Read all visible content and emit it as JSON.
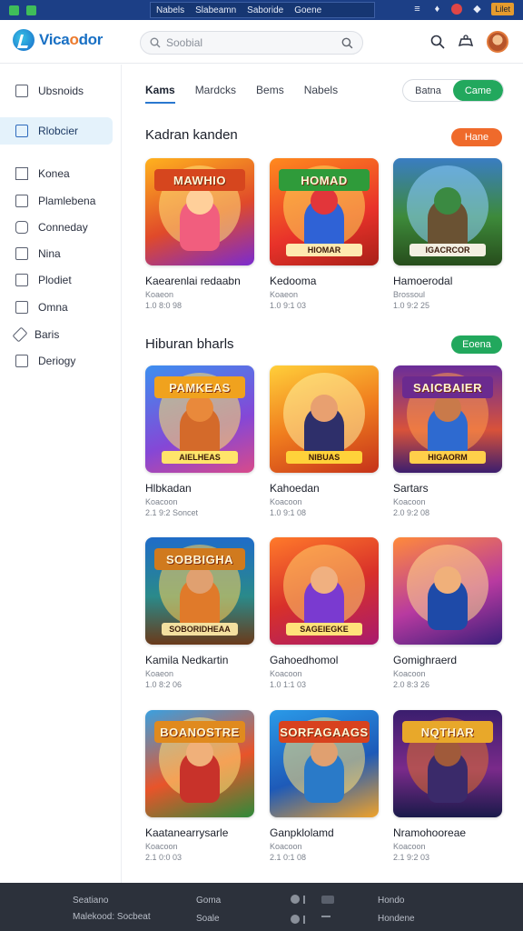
{
  "topbar": {
    "mid_items": [
      "Nabels",
      "Slabeamn",
      "Saboride",
      "Goene"
    ],
    "badge": "Lilet"
  },
  "header": {
    "logo_text_a": "Vica",
    "logo_text_b": "o",
    "logo_text_c": "dor",
    "search_placeholder": "Soobial"
  },
  "sidebar": {
    "items": [
      {
        "label": "Ubsnoids",
        "icon": "monitor-icon"
      },
      {
        "label": "Rlobcier",
        "icon": "calendar-icon"
      },
      {
        "label": "Konea",
        "icon": "triangle-icon"
      },
      {
        "label": "Plamlebena",
        "icon": "file-icon"
      },
      {
        "label": "Conneday",
        "icon": "chat-icon"
      },
      {
        "label": "Nina",
        "icon": "bookmark-icon"
      },
      {
        "label": "Plodiet",
        "icon": "check-icon"
      },
      {
        "label": "Omna",
        "icon": "display-icon"
      },
      {
        "label": "Baris",
        "icon": "pencil-icon"
      },
      {
        "label": "Deriogy",
        "icon": "square-icon"
      }
    ]
  },
  "tabs": [
    "Kams",
    "Mardcks",
    "Bems",
    "Nabels"
  ],
  "toggle": {
    "off": "Batna",
    "on": "Came"
  },
  "sections": [
    {
      "title": "Kadran kanden",
      "button": "Hane",
      "button_color": "#ef6a2b"
    },
    {
      "title": "Hiburan bharls",
      "button": "Eoena",
      "button_color": "#22a85d"
    }
  ],
  "cards": [
    {
      "name": "Kaearenlai redaabn",
      "meta1": "Koaeon",
      "meta2": "1.0 8:0 98",
      "banner": "MAWHIO",
      "plate": "",
      "bg": "linear-gradient(160deg,#ffb21e,#e04a2a 55%,#7a2bd0)",
      "sun": "#ffe27a",
      "char": "#f15e7e",
      "face": "#ffcf9a",
      "banner_bg": "#d6461e",
      "plate_bg": "#ffe27a"
    },
    {
      "name": "Kedooma",
      "meta1": "Koaeon",
      "meta2": "1.0 9:1 03",
      "banner": "HOMAD",
      "plate": "HIOMAR",
      "bg": "linear-gradient(160deg,#ff8a1e,#e8322a 60%,#a82018)",
      "sun": "#ffd85a",
      "char": "#2f62d6",
      "face": "#e2363a",
      "banner_bg": "#2f9b3a",
      "plate_bg": "#ffe9b0"
    },
    {
      "name": "Hamoerodal",
      "meta1": "Brossoul",
      "meta2": "1.0 9:2 25",
      "banner": "",
      "plate": "IGACRCOR",
      "bg": "linear-gradient(180deg,#3a7dc2,#3d8a3a 55%,#274d1c)",
      "sun": "#8fd0ff",
      "char": "#6a5233",
      "face": "#3b8a42",
      "banner_bg": "transparent",
      "plate_bg": "#f3efe2"
    },
    {
      "name": "Hlbkadan",
      "meta1": "Koacoon",
      "meta2": "2.1 9:2 Soncet",
      "banner": "PAMKEAS",
      "plate": "AIELHEAS",
      "bg": "linear-gradient(160deg,#3d8ff0,#8547d6 60%,#d84a8a)",
      "sun": "#ffe46a",
      "char": "#d46a2a",
      "face": "#e9893b",
      "banner_bg": "#f0a21e",
      "plate_bg": "#ffe46a"
    },
    {
      "name": "Kahoedan",
      "meta1": "Koacoon",
      "meta2": "1.0 9:1 08",
      "banner": "",
      "plate": "NIBUAS",
      "bg": "linear-gradient(160deg,#ffcf3a,#f07d1e 50%,#c5321a)",
      "sun": "#fff1a0",
      "char": "#2e2f6a",
      "face": "#e8a070",
      "banner_bg": "transparent",
      "plate_bg": "#ffd23a"
    },
    {
      "name": "Sartars",
      "meta1": "Koacoon",
      "meta2": "2.0 9:2 08",
      "banner": "SAICBAIER",
      "plate": "HIGAORM",
      "bg": "linear-gradient(180deg,#6a2d9a,#d8523a 60%,#3c1e6e)",
      "sun": "#ff9a4a",
      "char": "#2e6ad0",
      "face": "#c97a4a",
      "banner_bg": "#6b2a8f",
      "plate_bg": "#ffcf4a"
    },
    {
      "name": "Kamila Nedkartin",
      "meta1": "Koaeon",
      "meta2": "1.0 8:2 06",
      "banner": "SOBBIGHA",
      "plate": "SOBORIDHEAA",
      "bg": "linear-gradient(180deg,#1f6cc8,#2a8a8a 55%,#6a3a1a)",
      "sun": "#ffd25a",
      "char": "#e07a2a",
      "face": "#e0a070",
      "banner_bg": "#d07a1e",
      "plate_bg": "#f3e0a0"
    },
    {
      "name": "Gahoedhomol",
      "meta1": "Koacoon",
      "meta2": "1.0 1:1 03",
      "banner": "",
      "plate": "SAGEIEGKE",
      "bg": "linear-gradient(160deg,#ff7a2a,#d8302a 50%,#a81a6e)",
      "sun": "#ffd06a",
      "char": "#7a3ad0",
      "face": "#f0b080",
      "banner_bg": "transparent",
      "plate_bg": "#ffe27a"
    },
    {
      "name": "Gomighraerd",
      "meta1": "Koacoon",
      "meta2": "2.0 8:3 26",
      "banner": "",
      "plate": "",
      "bg": "linear-gradient(160deg,#ff8a3a,#b83aa0 55%,#3a1e7a)",
      "sun": "#ffd890",
      "char": "#1e4aa8",
      "face": "#f0b07a",
      "banner_bg": "transparent",
      "plate_bg": "transparent"
    },
    {
      "name": "Kaatanearrysarle",
      "meta1": "Koacoon",
      "meta2": "2.1 0:0 03",
      "banner": "BOANOSTRE",
      "plate": "",
      "bg": "linear-gradient(160deg,#3aa0e0,#e8542a 55%,#2e8a3a)",
      "sun": "#ffe27a",
      "char": "#c8322a",
      "face": "#f0b07a",
      "banner_bg": "#e08a1e",
      "plate_bg": "transparent"
    },
    {
      "name": "Ganpklolamd",
      "meta1": "Koacoon",
      "meta2": "2.1 0:1 08",
      "banner": "SORFAGAAGS",
      "plate": "",
      "bg": "linear-gradient(160deg,#2a9ae8,#1e5ab8 55%,#f0a22a)",
      "sun": "#ffe27a",
      "char": "#2a7ac8",
      "face": "#e0a070",
      "banner_bg": "#d8421e",
      "plate_bg": "transparent"
    },
    {
      "name": "Nramohooreae",
      "meta1": "Koacoon",
      "meta2": "2.1 9:2 03",
      "banner": "NQTHAR",
      "plate": "",
      "bg": "linear-gradient(180deg,#3a1e6e,#7a2a8a 55%,#1a1a4a)",
      "sun": "#e0702a",
      "char": "#3a2a6a",
      "face": "#a05a3a",
      "banner_bg": "#e8a82a",
      "plate_bg": "transparent"
    }
  ],
  "footer": {
    "col1_a": "Seatiano",
    "col1_b": "Malekood: Socbeat",
    "col2_a": "Goma",
    "col2_b": "Soale",
    "col3_a": "Hondo",
    "col3_b": "Hondene"
  }
}
